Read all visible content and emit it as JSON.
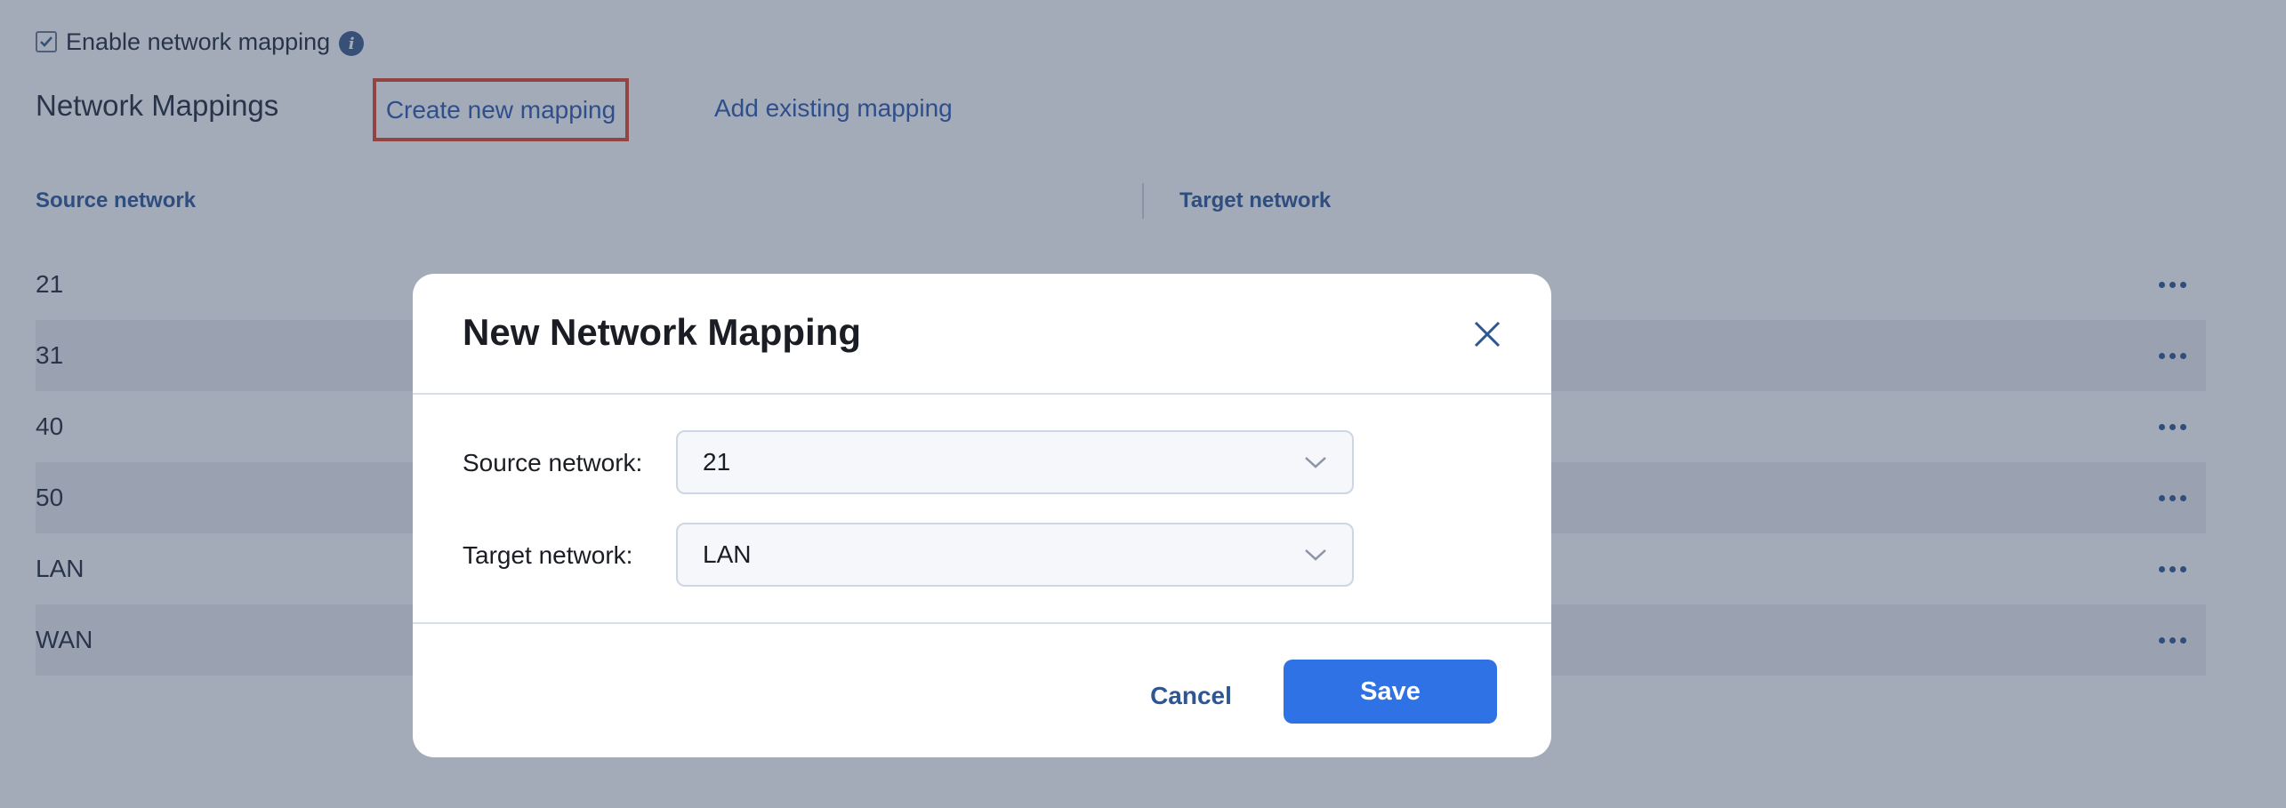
{
  "settings": {
    "enable_label": "Enable network mapping",
    "enable_checked": true,
    "section_title": "Network Mappings",
    "create_link": "Create new mapping",
    "add_link": "Add existing mapping"
  },
  "table": {
    "columns": [
      "Source network",
      "Target network"
    ],
    "rows": [
      {
        "source": "21"
      },
      {
        "source": "31"
      },
      {
        "source": "40"
      },
      {
        "source": "50"
      },
      {
        "source": "LAN"
      },
      {
        "source": "WAN"
      }
    ]
  },
  "modal": {
    "title": "New Network Mapping",
    "source_label": "Source network:",
    "source_value": "21",
    "target_label": "Target network:",
    "target_value": "LAN",
    "cancel_label": "Cancel",
    "save_label": "Save"
  },
  "icons": {
    "info": "info-icon",
    "close": "close-icon",
    "chevron": "chevron-down-icon",
    "more": "more-horizontal-icon",
    "check": "checkmark-icon"
  },
  "colors": {
    "primary": "#2f72e5",
    "link": "#2b5ab0",
    "highlight": "#e5462d"
  }
}
